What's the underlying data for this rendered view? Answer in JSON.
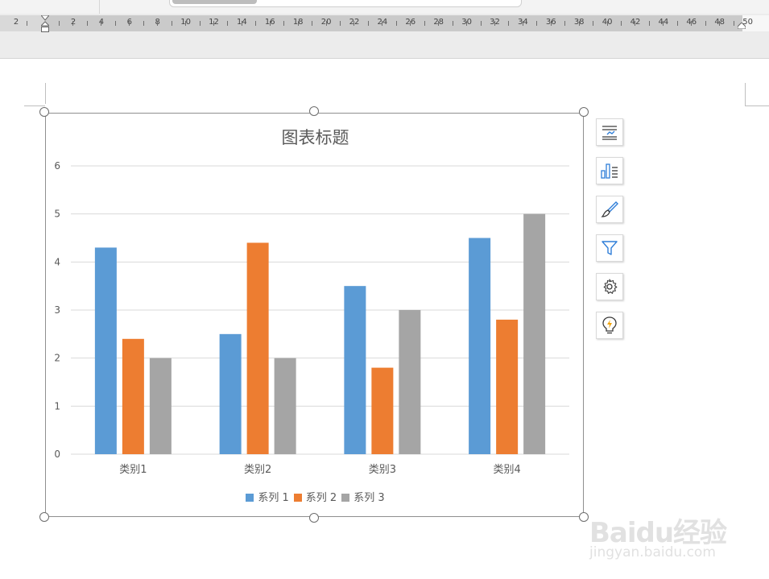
{
  "ruler": {
    "labels": [
      "2",
      "2",
      "4",
      "6",
      "8",
      "10",
      "12",
      "14",
      "16",
      "18",
      "20",
      "22",
      "24",
      "26",
      "28",
      "30",
      "32",
      "34",
      "36",
      "38",
      "40",
      "42",
      "44",
      "46",
      "48",
      "50"
    ]
  },
  "colors": {
    "series1": "#5b9bd5",
    "series2": "#ed7d31",
    "series3": "#a5a5a5",
    "gridline": "#d9d9d9",
    "axis_text": "#595959"
  },
  "chart_data": {
    "type": "bar",
    "title": "图表标题",
    "categories": [
      "类别1",
      "类别2",
      "类别3",
      "类别4"
    ],
    "series": [
      {
        "name": "系列 1",
        "values": [
          4.3,
          2.5,
          3.5,
          4.5
        ]
      },
      {
        "name": "系列 2",
        "values": [
          2.4,
          4.4,
          1.8,
          2.8
        ]
      },
      {
        "name": "系列 3",
        "values": [
          2,
          2,
          3,
          5
        ]
      }
    ],
    "ylim": [
      0,
      6
    ],
    "yticks": [
      0,
      1,
      2,
      3,
      4,
      5,
      6
    ],
    "grid": true,
    "legend_position": "bottom"
  },
  "side_toolbar": {
    "icons": [
      "chart-elements-icon",
      "chart-style-icon",
      "paintbrush-icon",
      "filter-icon",
      "settings-gear-icon",
      "lightbulb-icon"
    ]
  },
  "watermark": {
    "logo": "Baidu经验",
    "url": "jingyan.baidu.com"
  }
}
